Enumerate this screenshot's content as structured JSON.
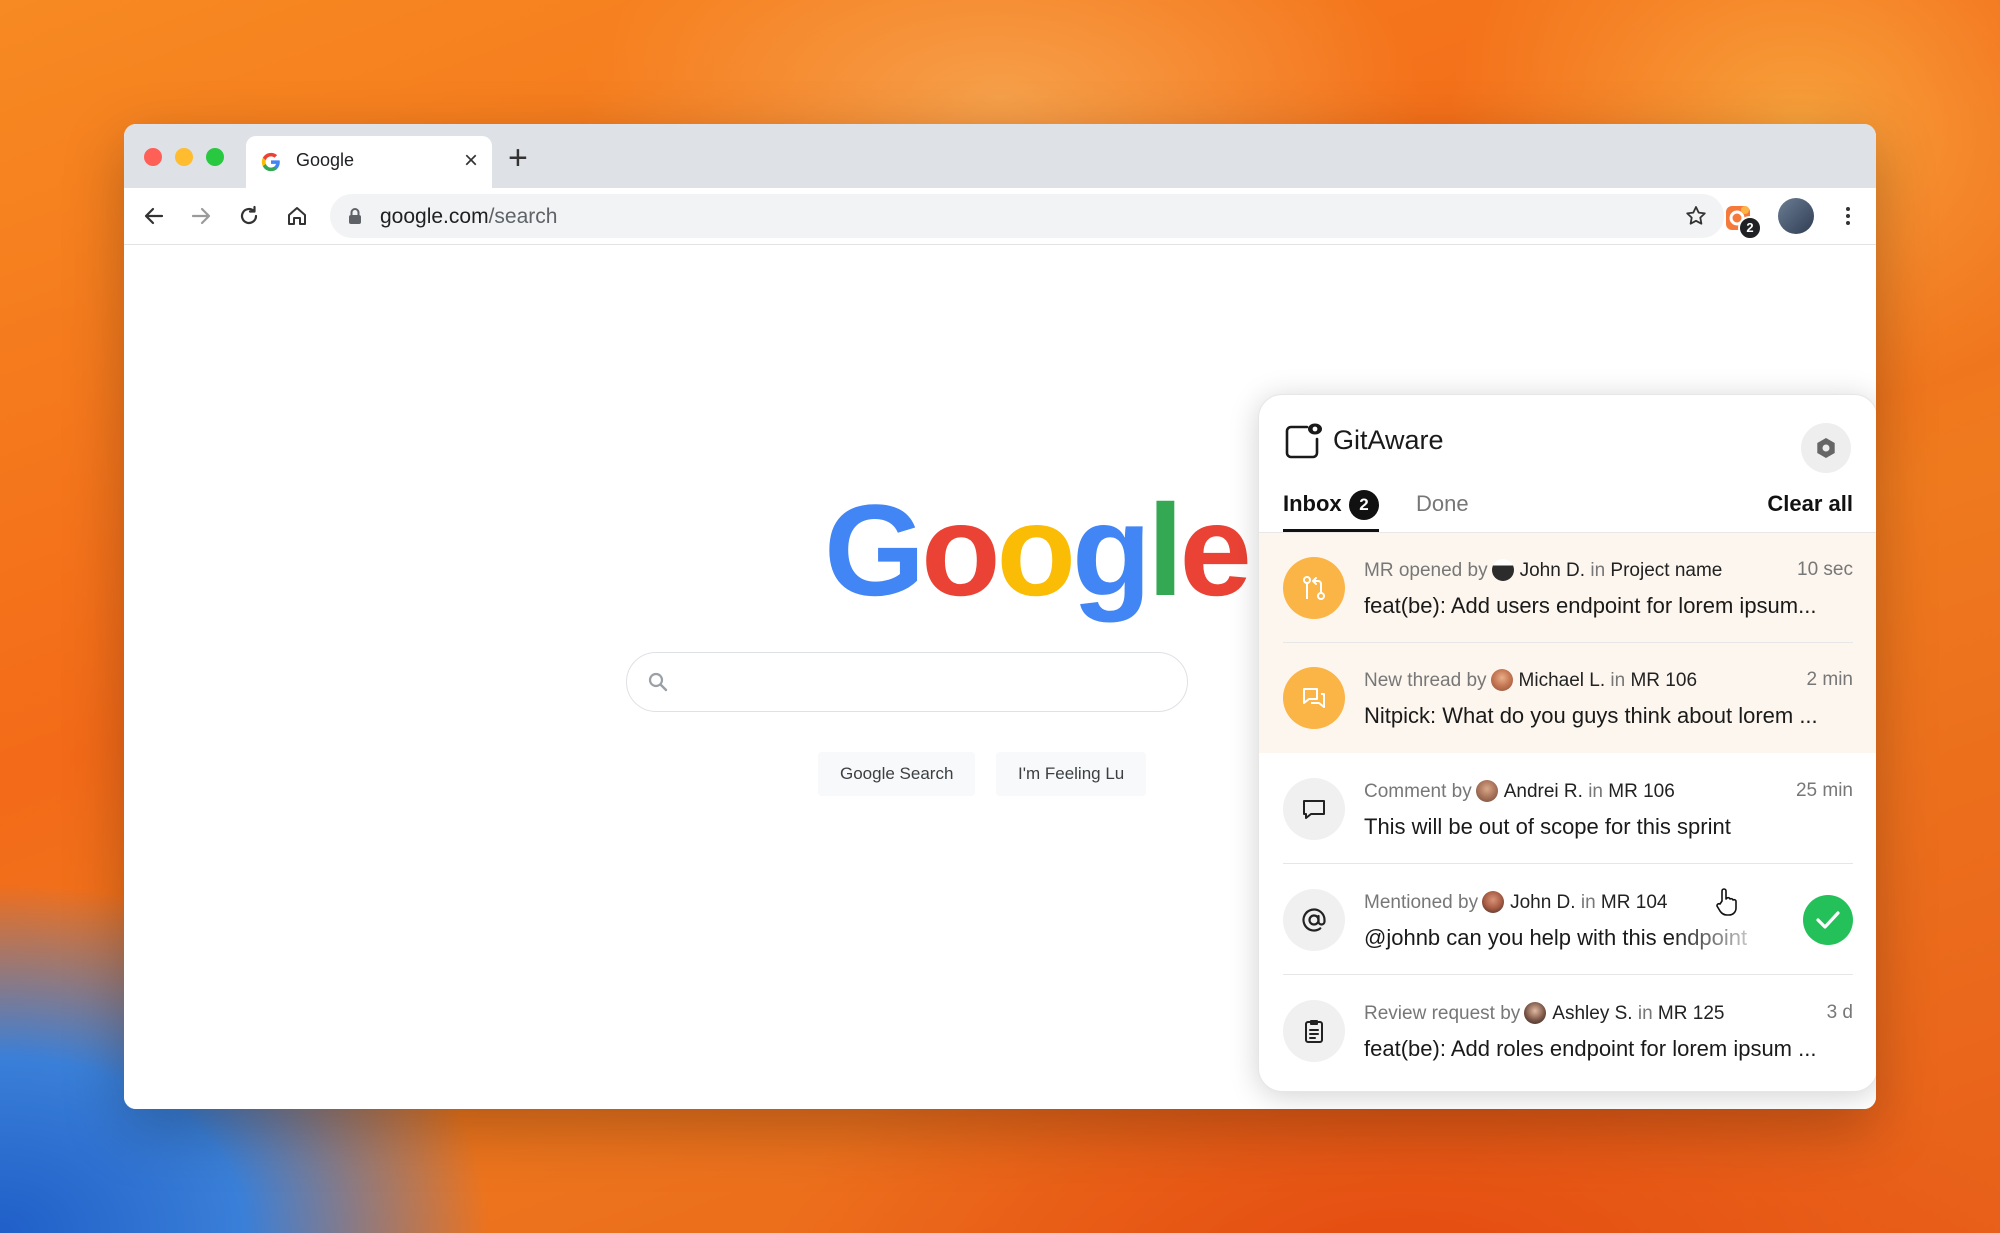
{
  "browser": {
    "tab_title": "Google",
    "url_host": "google.com",
    "url_path": "/search",
    "extension_badge": "2"
  },
  "google": {
    "logo_text": "Google",
    "search_button": "Google Search",
    "lucky_button": "I'm Feeling Lu"
  },
  "gitaware": {
    "title": "GitAware",
    "tabs": {
      "inbox": "Inbox",
      "inbox_count": "2",
      "done": "Done"
    },
    "clear_all": "Clear all",
    "items": [
      {
        "action": "MR opened by",
        "author": "John D.",
        "in": "in",
        "location": "Project name",
        "time": "10 sec",
        "message": "feat(be): Add users endpoint for lorem ipsum...",
        "icon": "merge-request-icon"
      },
      {
        "action": "New thread by",
        "author": "Michael L.",
        "in": "in",
        "location": "MR 106",
        "time": "2 min",
        "message": "Nitpick: What do you guys think about lorem ...",
        "icon": "thread-icon"
      },
      {
        "action": "Comment by",
        "author": "Andrei R.",
        "in": "in",
        "location": "MR 106",
        "time": "25 min",
        "message": "This will be out of scope for this sprint",
        "icon": "comment-icon"
      },
      {
        "action": "Mentioned by",
        "author": "John D.",
        "in": "in",
        "location": "MR 104",
        "time": "",
        "message": "@johnb can you help with this endpoint",
        "icon": "at-icon"
      },
      {
        "action": "Review request by",
        "author": "Ashley S.",
        "in": "in",
        "location": "MR 125",
        "time": "3 d",
        "message": "feat(be): Add roles endpoint for lorem ipsum ...",
        "icon": "clipboard-icon"
      }
    ]
  },
  "colors": {
    "accent_orange": "#fbb446",
    "done_green": "#24c05a",
    "highlight_bg": "#fdf6ee"
  }
}
